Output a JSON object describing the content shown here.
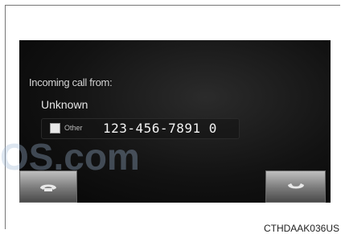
{
  "dialog": {
    "title": "Incoming call from:",
    "caller_name": "Unknown",
    "number_type": "Other",
    "phone_number": "123-456-7891 0"
  },
  "buttons": {
    "answer_icon": "phone-pickup-icon",
    "decline_icon": "phone-hangup-icon"
  },
  "watermark": "OS.com",
  "image_code": "CTHDAAK036US"
}
